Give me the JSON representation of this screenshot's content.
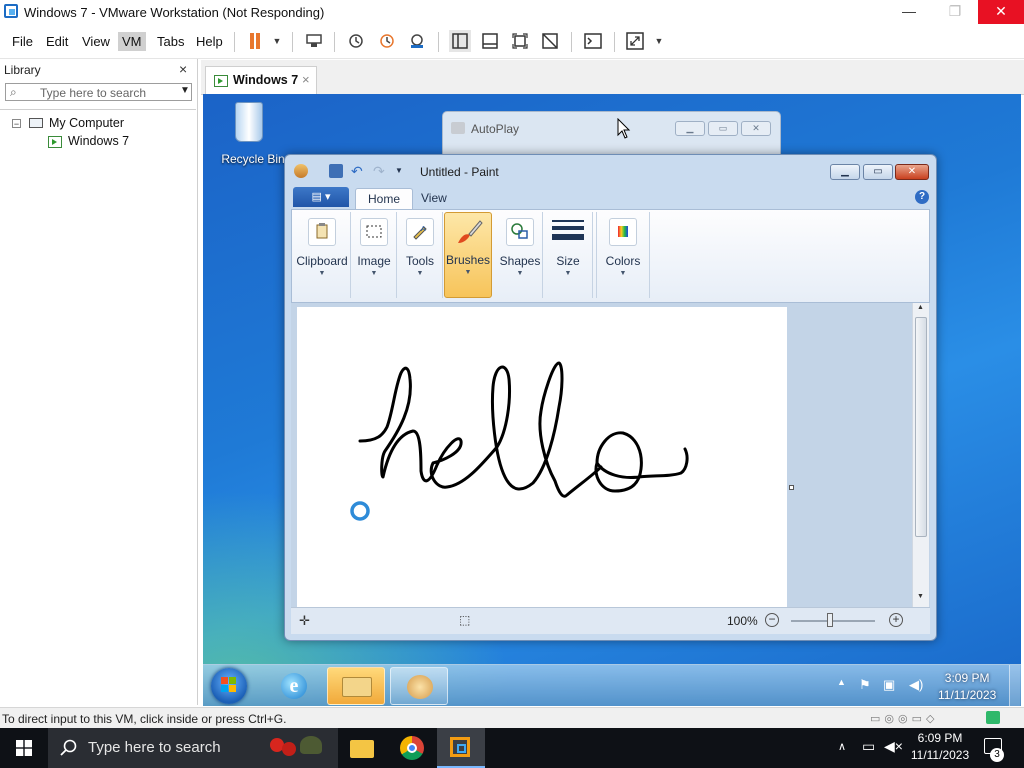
{
  "window": {
    "title": "Windows 7 - VMware Workstation (Not Responding)",
    "minimize_glyph": "—",
    "restore_glyph": "❐",
    "close_glyph": "✕"
  },
  "menu": [
    "File",
    "Edit",
    "View",
    "VM",
    "Tabs",
    "Help"
  ],
  "library": {
    "title": "Library",
    "close_glyph": "×",
    "search_placeholder": "Type here to search",
    "tree": [
      {
        "label": "My Computer",
        "expander": "−"
      },
      {
        "label": "Windows 7"
      }
    ]
  },
  "vm_tab": {
    "label": "Windows 7",
    "close_glyph": "×"
  },
  "guest": {
    "recycle_bin": "Recycle Bin",
    "autoplay": {
      "title": "AutoPlay"
    },
    "paint": {
      "title": "Untitled - Paint",
      "tabs": [
        "Home",
        "View"
      ],
      "help_glyph": "?",
      "groups": [
        "Clipboard",
        "Image",
        "Tools",
        "Brushes",
        "Shapes",
        "Size",
        "Colors"
      ],
      "active_group": "Brushes",
      "zoom": "100%"
    },
    "taskbar": {
      "time": "3:09 PM",
      "date": "11/11/2023"
    }
  },
  "status_text": "To direct input to this VM, click inside or press Ctrl+G.",
  "host": {
    "search_placeholder": "Type here to search",
    "time": "6:09 PM",
    "date": "11/11/2023",
    "notification_count": "3"
  },
  "colors": {
    "vmware_pause": "#e8772e",
    "win7_blue": "#1f7ad6",
    "close_red": "#e81123"
  }
}
